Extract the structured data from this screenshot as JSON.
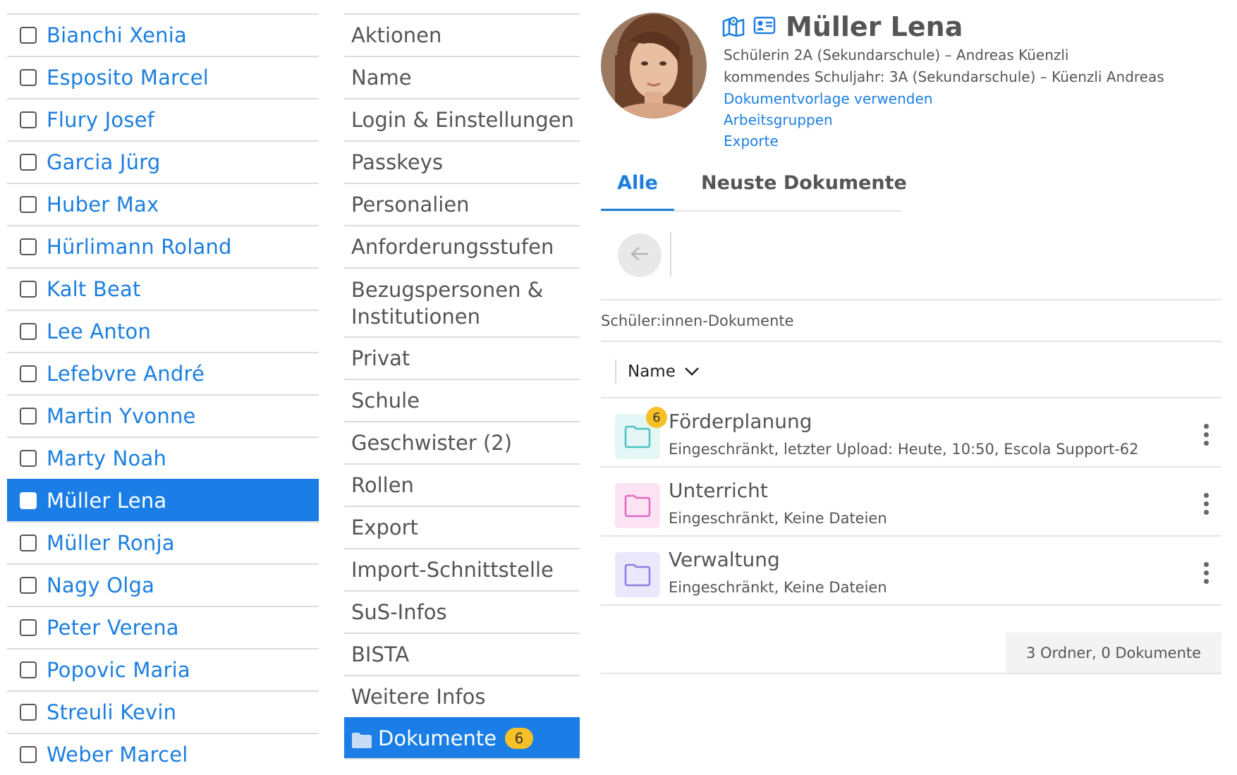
{
  "students": [
    {
      "name": "Bianchi Xenia",
      "selected": false
    },
    {
      "name": "Esposito Marcel",
      "selected": false
    },
    {
      "name": "Flury Josef",
      "selected": false
    },
    {
      "name": "Garcia Jürg",
      "selected": false
    },
    {
      "name": "Huber Max",
      "selected": false
    },
    {
      "name": "Hürlimann Roland",
      "selected": false
    },
    {
      "name": "Kalt Beat",
      "selected": false
    },
    {
      "name": "Lee Anton",
      "selected": false
    },
    {
      "name": "Lefebvre André",
      "selected": false
    },
    {
      "name": "Martin Yvonne",
      "selected": false
    },
    {
      "name": "Marty Noah",
      "selected": false
    },
    {
      "name": "Müller Lena",
      "selected": true
    },
    {
      "name": "Müller Ronja",
      "selected": false
    },
    {
      "name": "Nagy Olga",
      "selected": false
    },
    {
      "name": "Peter Verena",
      "selected": false
    },
    {
      "name": "Popovic Maria",
      "selected": false
    },
    {
      "name": "Streuli Kevin",
      "selected": false
    },
    {
      "name": "Weber Marcel",
      "selected": false
    }
  ],
  "menu": {
    "items": [
      "Aktionen",
      "Name",
      "Login & Einstellungen",
      "Passkeys",
      "Personalien",
      "Anforderungsstufen",
      "Bezugspersonen & Institutionen",
      "Privat",
      "Schule",
      "Geschwister (2)",
      "Rollen",
      "Export",
      "Import-Schnittstelle",
      "SuS-Infos",
      "BISTA",
      "Weitere Infos"
    ],
    "documents_label": "Dokumente",
    "documents_badge": "6"
  },
  "profile": {
    "name": "Müller Lena",
    "class_line": "Schülerin 2A (Sekundarschule) – Andreas Küenzli",
    "next_year_line": "kommendes Schuljahr: 3A (Sekundarschule) – Küenzli Andreas",
    "links": [
      "Dokumentvorlage verwenden",
      "Arbeitsgruppen",
      "Exporte"
    ],
    "icons": [
      "map-icon",
      "id-card-icon"
    ]
  },
  "tabs": {
    "all": "Alle",
    "recent": "Neuste Dokumente"
  },
  "breadcrumb": "Schüler:innen-Dokumente",
  "sort_label": "Name",
  "folders": [
    {
      "name": "Förderplanung",
      "meta": "Eingeschränkt, letzter Upload: Heute, 10:50, Escola Support-62",
      "badge": "6",
      "color": "#4cc3c0",
      "bg": "#e4f6f6"
    },
    {
      "name": "Unterricht",
      "meta": "Eingeschränkt, Keine Dateien",
      "badge": null,
      "color": "#e06ac2",
      "bg": "#fbe3f3"
    },
    {
      "name": "Verwaltung",
      "meta": "Eingeschränkt, Keine Dateien",
      "badge": null,
      "color": "#8c7fe0",
      "bg": "#ebe8fb"
    }
  ],
  "summary": "3 Ordner, 0 Dokumente",
  "colors": {
    "accent": "#1a7ee6",
    "link": "#1c7fe0",
    "badge": "#f6c026"
  }
}
